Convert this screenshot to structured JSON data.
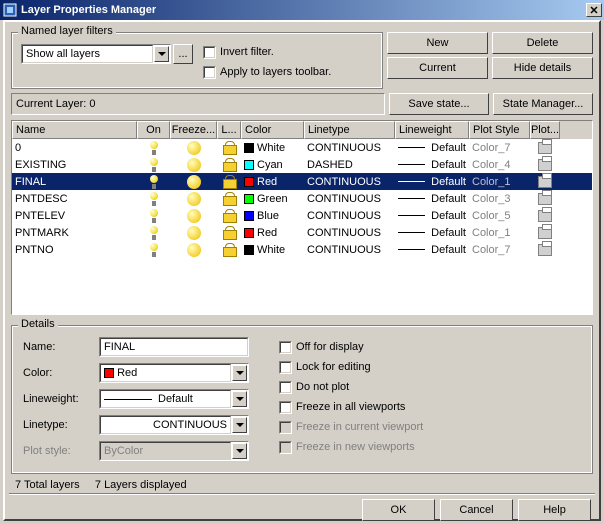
{
  "window": {
    "title": "Layer Properties Manager",
    "close": "✕"
  },
  "filters": {
    "group": "Named layer filters",
    "combo": "Show all layers",
    "browse": "...",
    "invert": "Invert filter.",
    "apply": "Apply to layers toolbar."
  },
  "buttons": {
    "new": "New",
    "delete": "Delete",
    "current": "Current",
    "hide": "Hide details",
    "save": "Save state...",
    "state": "State Manager..."
  },
  "current_layer": "Current Layer:  0",
  "columns": {
    "name": "Name",
    "on": "On",
    "freeze": "Freeze...",
    "l": "L...",
    "color": "Color",
    "linetype": "Linetype",
    "lineweight": "Lineweight",
    "plotstyle": "Plot Style",
    "plot": "Plot..."
  },
  "rows": [
    {
      "name": "0",
      "color": "White",
      "swatch": "#000000",
      "linetype": "CONTINUOUS",
      "lineweight": "Default",
      "plotstyle": "Color_7",
      "sel": false
    },
    {
      "name": "EXISTING",
      "color": "Cyan",
      "swatch": "#00ffff",
      "linetype": "DASHED",
      "lineweight": "Default",
      "plotstyle": "Color_4",
      "sel": false
    },
    {
      "name": "FINAL",
      "color": "Red",
      "swatch": "#ff0000",
      "linetype": "CONTINUOUS",
      "lineweight": "Default",
      "plotstyle": "Color_1",
      "sel": true
    },
    {
      "name": "PNTDESC",
      "color": "Green",
      "swatch": "#00ff00",
      "linetype": "CONTINUOUS",
      "lineweight": "Default",
      "plotstyle": "Color_3",
      "sel": false
    },
    {
      "name": "PNTELEV",
      "color": "Blue",
      "swatch": "#0000ff",
      "linetype": "CONTINUOUS",
      "lineweight": "Default",
      "plotstyle": "Color_5",
      "sel": false
    },
    {
      "name": "PNTMARK",
      "color": "Red",
      "swatch": "#ff0000",
      "linetype": "CONTINUOUS",
      "lineweight": "Default",
      "plotstyle": "Color_1",
      "sel": false
    },
    {
      "name": "PNTNO",
      "color": "White",
      "swatch": "#000000",
      "linetype": "CONTINUOUS",
      "lineweight": "Default",
      "plotstyle": "Color_7",
      "sel": false
    }
  ],
  "details": {
    "group": "Details",
    "name_l": "Name:",
    "name_v": "FINAL",
    "color_l": "Color:",
    "color_v": "Red",
    "color_sw": "#ff0000",
    "lw_l": "Lineweight:",
    "lw_v": "Default",
    "lt_l": "Linetype:",
    "lt_v": "CONTINUOUS",
    "ps_l": "Plot style:",
    "ps_v": "ByColor",
    "off": "Off for display",
    "lock": "Lock for editing",
    "noplot": "Do not plot",
    "fav": "Freeze in all viewports",
    "fcv": "Freeze in current viewport",
    "fnv": "Freeze in new viewports"
  },
  "status": {
    "total": "7 Total layers",
    "displayed": "7 Layers displayed"
  },
  "bottom": {
    "ok": "OK",
    "cancel": "Cancel",
    "help": "Help"
  }
}
